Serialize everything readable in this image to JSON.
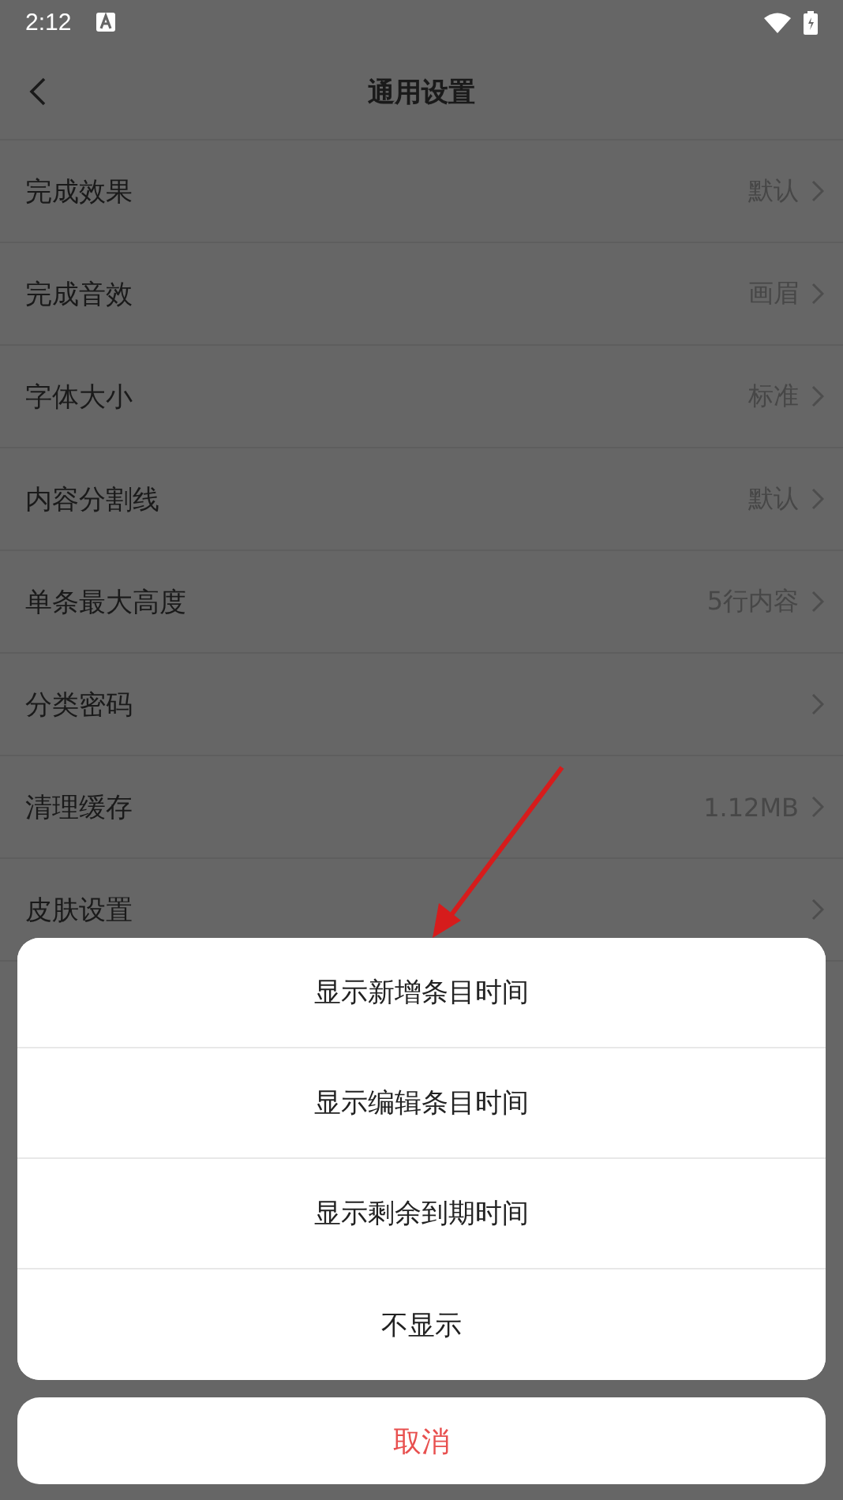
{
  "status_bar": {
    "time": "2:12"
  },
  "header": {
    "title": "通用设置"
  },
  "settings": [
    {
      "label": "完成效果",
      "value": "默认"
    },
    {
      "label": "完成音效",
      "value": "画眉"
    },
    {
      "label": "字体大小",
      "value": "标准"
    },
    {
      "label": "内容分割线",
      "value": "默认"
    },
    {
      "label": "单条最大高度",
      "value": "5行内容"
    },
    {
      "label": "分类密码"
    },
    {
      "label": "清理缓存",
      "value": "1.12MB"
    },
    {
      "label": "皮肤设置"
    }
  ],
  "action_sheet": {
    "options": [
      "显示新增条目时间",
      "显示编辑条目时间",
      "显示剩余到期时间",
      "不显示"
    ],
    "cancel": "取消"
  }
}
